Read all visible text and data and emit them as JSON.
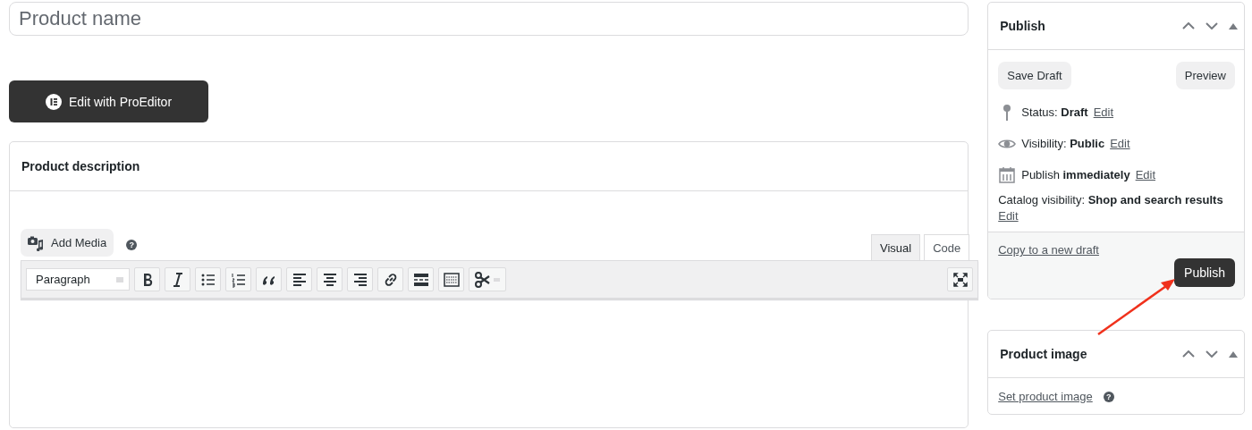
{
  "title_field": {
    "placeholder": "Product name"
  },
  "editor_button": {
    "label": "Edit with ProEditor"
  },
  "description": {
    "title": "Product description",
    "add_media": "Add Media",
    "help": "?",
    "tabs": [
      {
        "label": "Visual",
        "selected": true
      },
      {
        "label": "Code",
        "selected": false
      }
    ],
    "format_select": "Paragraph"
  },
  "publish": {
    "title": "Publish",
    "save_draft": "Save Draft",
    "preview": "Preview",
    "rows": [
      {
        "kind": "pin",
        "text": "Status: **Draft**",
        "link": "Edit"
      },
      {
        "kind": "eye",
        "text": "Visibility: **Public**",
        "link": "Edit"
      },
      {
        "kind": "calendar",
        "text": "Publish **immediately**",
        "link": "Edit"
      }
    ],
    "catalog": {
      "text": "Catalog visibility: **Shop and search results**",
      "link": "Edit"
    },
    "copy_link": "Copy to a new draft",
    "publish_button": "Publish"
  },
  "product_image": {
    "title": "Product image",
    "link": "Set product image",
    "help": "?"
  }
}
